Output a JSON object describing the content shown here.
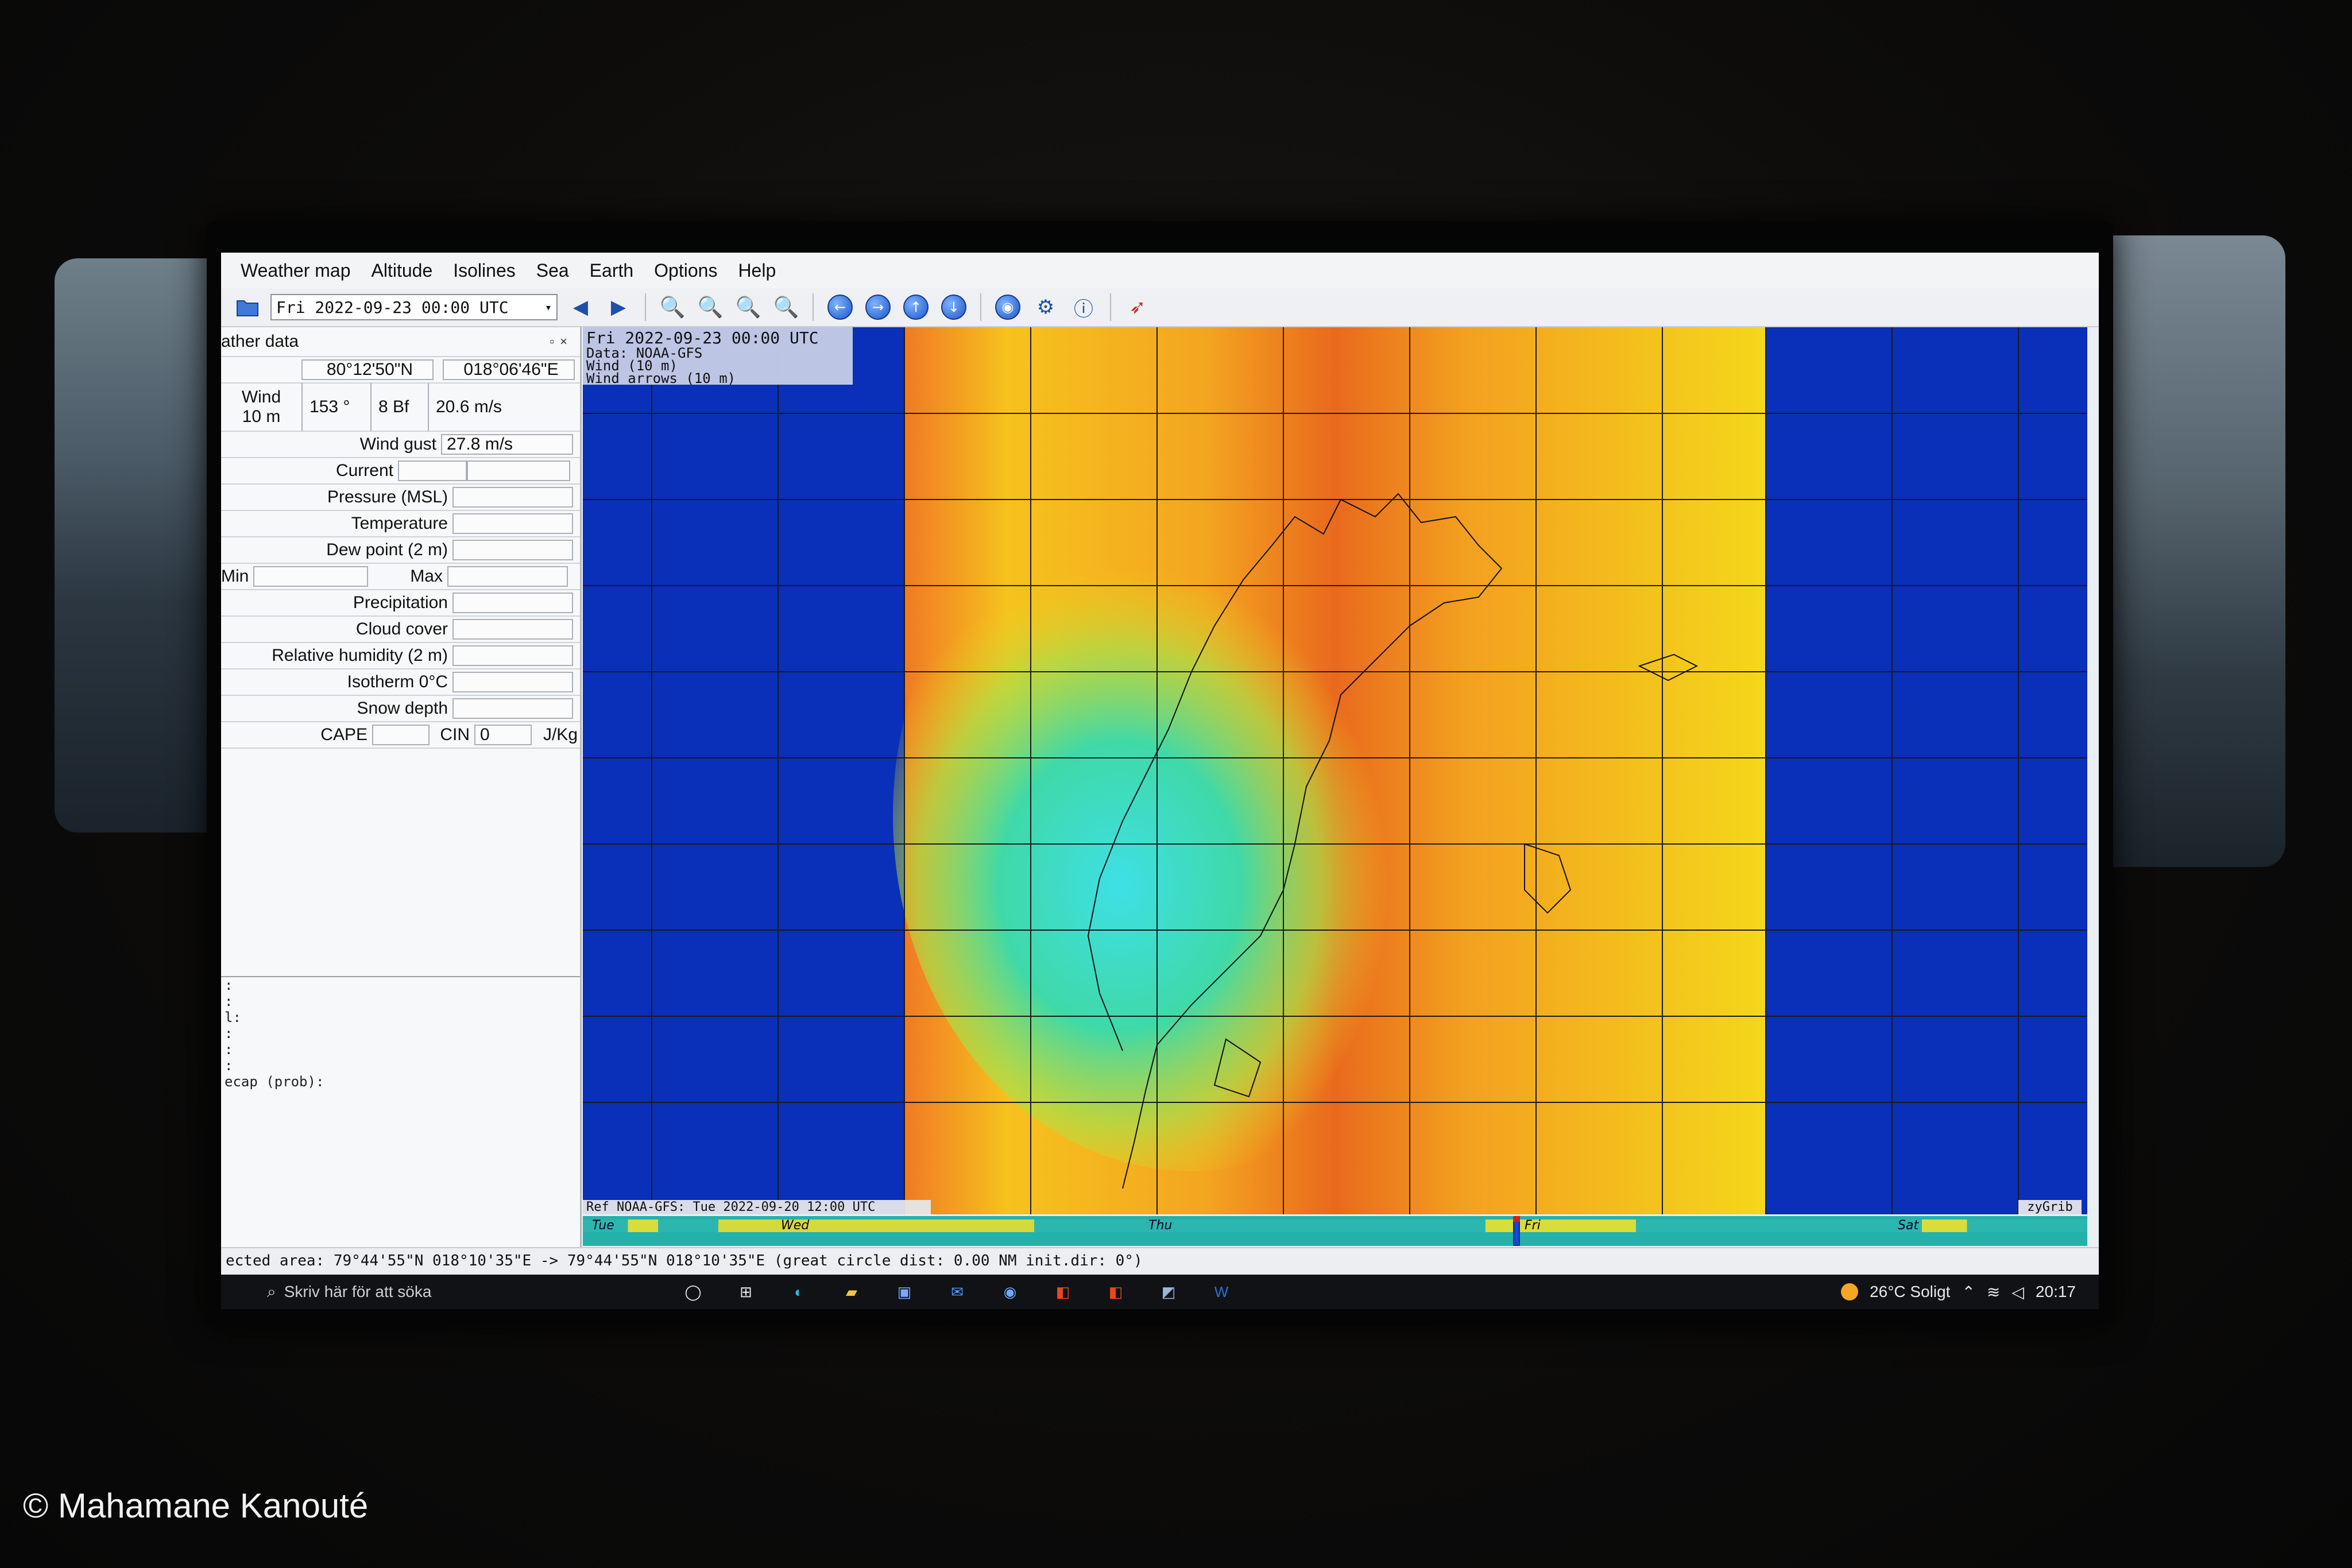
{
  "menu": [
    "Weather map",
    "Altitude",
    "Isolines",
    "Sea",
    "Earth",
    "Options",
    "Help"
  ],
  "toolbar": {
    "date_value": "Fri 2022-09-23 00:00 UTC"
  },
  "panel": {
    "title": "ather data",
    "lat": "80°12'50\"N",
    "lon": "018°06'46\"E",
    "wind_label_1": "Wind",
    "wind_label_2": "10 m",
    "wind_dir": "153 °",
    "wind_bf": "8 Bf",
    "wind_speed": "20.6  m/s",
    "gust_label": "Wind gust",
    "gust_value": "27.8  m/s",
    "current": "Current",
    "pressure": "Pressure (MSL)",
    "temperature": "Temperature",
    "dewpoint": "Dew point (2 m)",
    "min": "Min",
    "max": "Max",
    "precip": "Precipitation",
    "cloud": "Cloud cover",
    "humidity": "Relative humidity (2 m)",
    "isotherm": "Isotherm 0°C",
    "snow": "Snow depth",
    "cape": "CAPE",
    "cin": "CIN",
    "cin_value": "0",
    "unit": "J/Kg",
    "log_lines": [
      ":",
      ":",
      "l:",
      ":",
      ":",
      ":",
      "ecap (prob):"
    ]
  },
  "map": {
    "legend_line1": "Fri 2022-09-23 00:00 UTC",
    "legend_line2": "Data: NOAA-GFS",
    "legend_line3": "Wind (10 m)",
    "legend_line4": "Wind arrows (10 m)",
    "ref": "Ref NOAA-GFS: Tue 2022-09-20 12:00 UTC",
    "brand": "zyGrib"
  },
  "timeline": {
    "days": [
      "Tue",
      "Wed",
      "Thu",
      "Fri",
      "Sat"
    ]
  },
  "status": "ected area:  79°44'55\"N  018°10'35\"E ->  79°44'55\"N  018°10'35\"E   (great circle dist: 0.00 NM  init.dir: 0°)",
  "taskbar": {
    "search": "Skriv här för att söka",
    "weather": "26°C  Soligt",
    "time": "20:17"
  },
  "copyright": "© Mahamane Kanouté",
  "colors": {
    "sea": "#0a2fb8",
    "wind_high": "#e8621c",
    "wind_mid": "#f2d41c",
    "wind_low": "#2fd3c6"
  }
}
